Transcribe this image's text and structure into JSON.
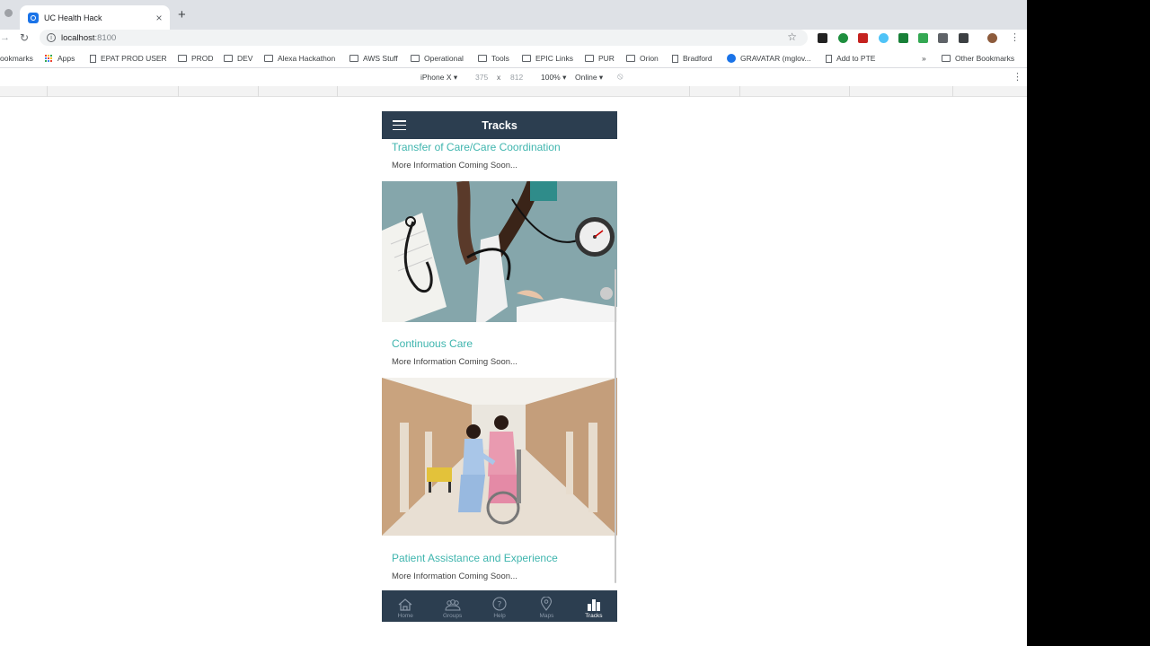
{
  "browser": {
    "tab_title": "UC Health Hack",
    "url_host": "localhost",
    "url_port": ":8100",
    "bookmarks": [
      {
        "label": "ookmarks",
        "icon": "none"
      },
      {
        "label": "Apps",
        "icon": "apps-icon"
      },
      {
        "label": "EPAT PROD USER",
        "icon": "page-icon"
      },
      {
        "label": "PROD",
        "icon": "folder-icon"
      },
      {
        "label": "DEV",
        "icon": "folder-icon"
      },
      {
        "label": "Alexa Hackathon",
        "icon": "folder-icon"
      },
      {
        "label": "AWS Stuff",
        "icon": "folder-icon"
      },
      {
        "label": "Operational",
        "icon": "folder-icon"
      },
      {
        "label": "Tools",
        "icon": "folder-icon"
      },
      {
        "label": "EPIC Links",
        "icon": "folder-icon"
      },
      {
        "label": "PUR",
        "icon": "folder-icon"
      },
      {
        "label": "Orion",
        "icon": "folder-icon"
      },
      {
        "label": "Bradford",
        "icon": "page-icon"
      },
      {
        "label": "GRAVATAR (mglov...",
        "icon": "power-icon"
      },
      {
        "label": "Add to PTE",
        "icon": "page-icon"
      },
      {
        "label": "»",
        "icon": "none"
      },
      {
        "label": "Other Bookmarks",
        "icon": "folder-icon"
      }
    ]
  },
  "devtools": {
    "device": "iPhone X ▾",
    "width": "375",
    "times": "x",
    "height": "812",
    "zoom": "100% ▾",
    "network": "Online ▾"
  },
  "app": {
    "title": "Tracks",
    "cards": [
      {
        "title": "Transfer of Care/Care Coordination",
        "text": "More Information Coming Soon..."
      },
      {
        "title": "Continuous Care",
        "text": "More Information Coming Soon..."
      },
      {
        "title": "Patient Assistance and Experience",
        "text": "More Information Coming Soon..."
      }
    ],
    "tabs": [
      {
        "label": "Home",
        "icon": "home-icon",
        "active": false
      },
      {
        "label": "Groups",
        "icon": "groups-icon",
        "active": false
      },
      {
        "label": "Help",
        "icon": "help-icon",
        "active": false
      },
      {
        "label": "Maps",
        "icon": "map-pin-icon",
        "active": false
      },
      {
        "label": "Tracks",
        "icon": "bar-chart-icon",
        "active": true
      }
    ]
  },
  "colors": {
    "header_bg": "#2c3e50",
    "accent": "#3fb5ae",
    "tab_inactive": "#8a98a8"
  }
}
